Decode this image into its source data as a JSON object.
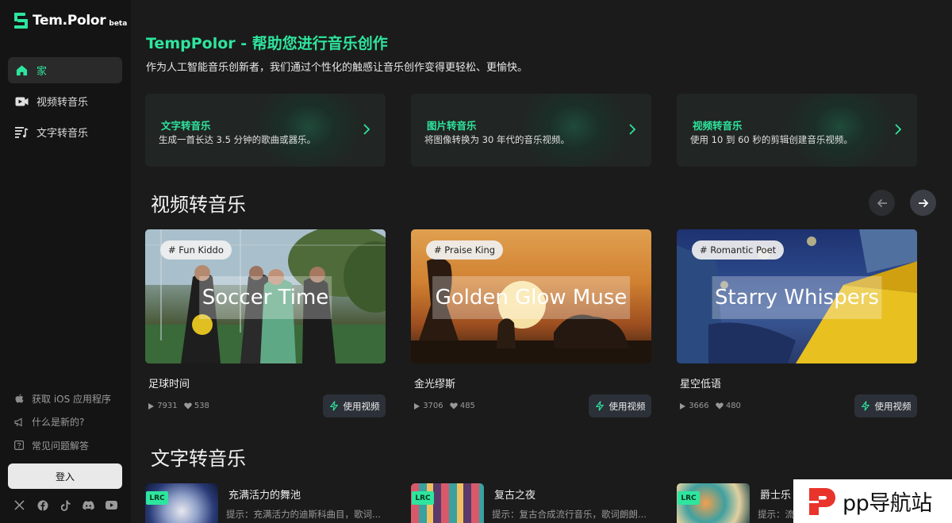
{
  "logo": {
    "name": "Tem.Polor",
    "badge": "beta"
  },
  "sidebar": {
    "nav": [
      {
        "label": "家",
        "icon": "home-icon",
        "active": true
      },
      {
        "label": "视频转音乐",
        "icon": "video-camera-icon"
      },
      {
        "label": "文字转音乐",
        "icon": "text-lines-icon"
      }
    ],
    "links": [
      {
        "label": "获取 iOS 应用程序",
        "icon": "apple-icon"
      },
      {
        "label": "什么是新的?",
        "icon": "megaphone-icon"
      },
      {
        "label": "常见问题解答",
        "icon": "question-icon"
      }
    ],
    "login": "登入",
    "socials": [
      "x-icon",
      "facebook-icon",
      "tiktok-icon",
      "discord-icon",
      "youtube-icon"
    ]
  },
  "header": {
    "title": "TempPolor - 帮助您进行音乐创作",
    "subtitle": "作为人工智能音乐创新者，我们通过个性化的触感让音乐创作变得更轻松、更愉快。"
  },
  "features": [
    {
      "title": "文字转音乐",
      "desc": "生成一首长达 3.5 分钟的歌曲或器乐。"
    },
    {
      "title": "图片转音乐",
      "desc": "将图像转换为 30 年代的音乐视频。"
    },
    {
      "title": "视频转音乐",
      "desc": "使用 10 到 60 秒的剪辑创建音乐视频。"
    }
  ],
  "video_section": {
    "title": "视频转音乐",
    "cards": [
      {
        "tag": "# Fun Kiddo",
        "overlay": "Soccer Time",
        "name": "足球时间",
        "plays": "7931",
        "likes": "538",
        "button": "使用视频"
      },
      {
        "tag": "# Praise King",
        "overlay": "Golden Glow Muse",
        "name": "金光缪斯",
        "plays": "3706",
        "likes": "485",
        "button": "使用视频"
      },
      {
        "tag": "# Romantic Poet",
        "overlay": "Starry Whispers",
        "name": "星空低语",
        "plays": "3666",
        "likes": "480",
        "button": "使用视频"
      }
    ]
  },
  "text_section": {
    "title": "文字转音乐",
    "cards": [
      {
        "badge": "LRC",
        "name": "充满活力的舞池",
        "desc": "提示：充满活力的迪斯科曲目，歌词..."
      },
      {
        "badge": "LRC",
        "name": "复古之夜",
        "desc": "提示：复古合成流行音乐，歌词朗朗..."
      },
      {
        "badge": "LRC",
        "name": "爵士乐",
        "desc": "提示：流"
      }
    ]
  },
  "watermark": {
    "text": "pp导航站"
  },
  "colors": {
    "accent": "#2ee59d",
    "sidebar": "#141414",
    "background": "#1b1b1b"
  }
}
